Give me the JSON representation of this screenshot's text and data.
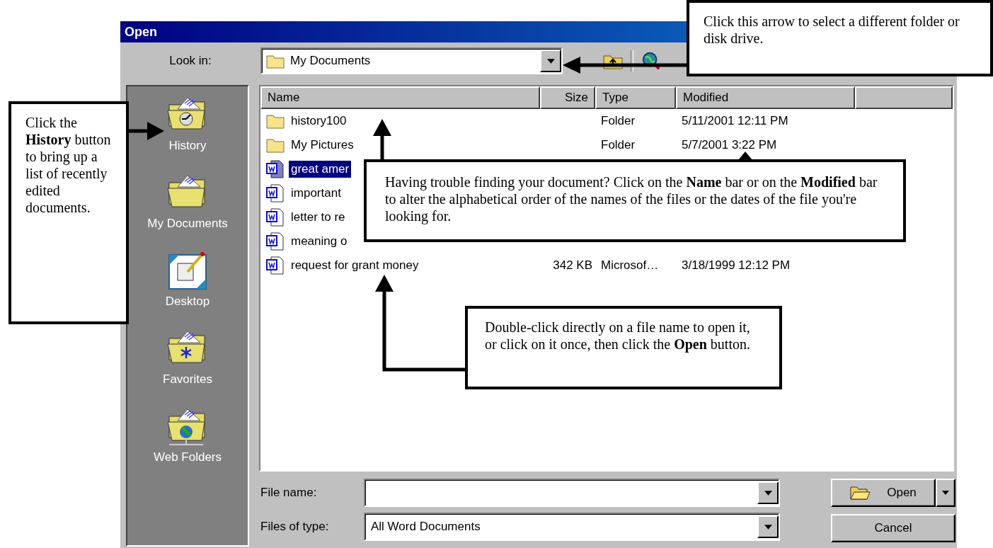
{
  "window": {
    "title": "Open"
  },
  "look_in": {
    "label": "Look in:",
    "value": "My Documents"
  },
  "places": [
    {
      "kind": "history",
      "label": "History"
    },
    {
      "kind": "folder",
      "label": "My Documents"
    },
    {
      "kind": "desktop",
      "label": "Desktop"
    },
    {
      "kind": "favorites",
      "label": "Favorites"
    },
    {
      "kind": "web",
      "label": "Web Folders"
    }
  ],
  "file_list": {
    "columns": [
      "Name",
      "Size",
      "Type",
      "Modified"
    ],
    "rows": [
      {
        "kind": "folder",
        "name": "history100",
        "type": "Folder",
        "modified": "5/11/2001 12:11 PM",
        "selected": false
      },
      {
        "kind": "folder",
        "name": "My Pictures",
        "type": "Folder",
        "modified": "5/7/2001 3:22 PM",
        "selected": false
      },
      {
        "kind": "document",
        "name": "great amer",
        "selected": true
      },
      {
        "kind": "document",
        "name": "important",
        "selected": false
      },
      {
        "kind": "document",
        "name": "letter to re",
        "selected": false
      },
      {
        "kind": "document",
        "name": "meaning o",
        "selected": false
      },
      {
        "kind": "document",
        "name": "request for grant money",
        "size": "342 KB",
        "type": "Microsof…",
        "modified": "3/18/1999 12:12 PM",
        "selected": false
      }
    ]
  },
  "file_name": {
    "label": "File name:"
  },
  "file_type": {
    "label": "Files of type:",
    "value": "All Word Documents"
  },
  "buttons": [
    {
      "kind": "split",
      "label": "Open"
    },
    {
      "kind": "plain",
      "label": "Cancel"
    }
  ],
  "callouts": [
    {
      "text": "Click this arrow to select a different folder or disk drive."
    },
    {
      "text": "Click the **History** button to bring up a list of recently edited documents."
    },
    {
      "text": "Having trouble finding your document?  Click on the **Name** bar or on the **Modified** bar to alter the alphabetical order of the names of the files or the dates of the file you're looking for."
    },
    {
      "text": "Double-click directly on a file name to open it, or click on it once, then click the **Open** button."
    }
  ]
}
